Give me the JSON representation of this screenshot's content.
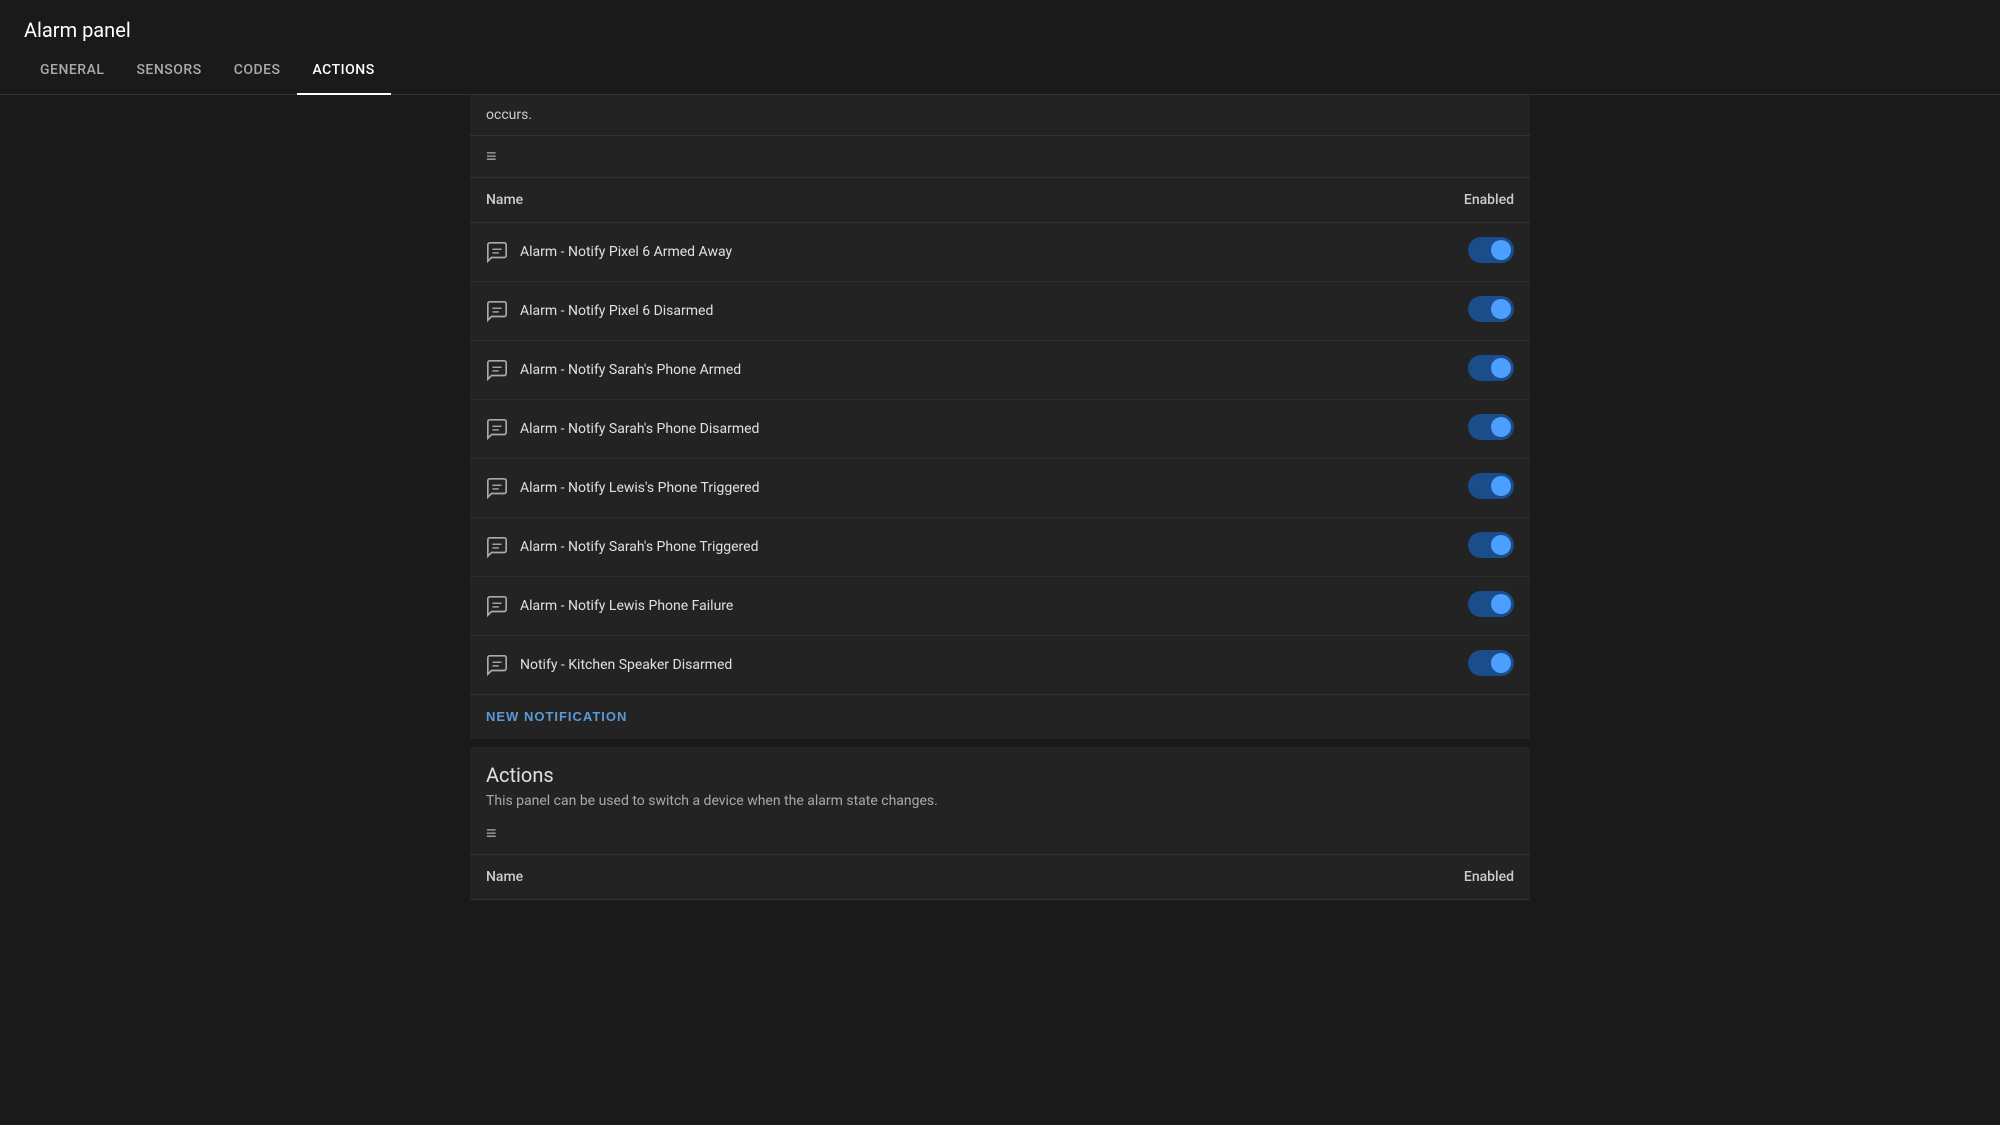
{
  "app": {
    "title": "Alarm panel"
  },
  "tabs": [
    {
      "id": "general",
      "label": "GENERAL",
      "active": false
    },
    {
      "id": "sensors",
      "label": "SENSORS",
      "active": false
    },
    {
      "id": "codes",
      "label": "CODES",
      "active": false
    },
    {
      "id": "actions",
      "label": "ACTIONS",
      "active": true
    }
  ],
  "partial_text": "occurs.",
  "notifications": {
    "filter_icon": "≡",
    "col_name": "Name",
    "col_enabled": "Enabled",
    "items": [
      {
        "id": 1,
        "name": "Alarm - Notify Pixel 6 Armed Away",
        "enabled": true
      },
      {
        "id": 2,
        "name": "Alarm - Notify Pixel 6 Disarmed",
        "enabled": true
      },
      {
        "id": 3,
        "name": "Alarm - Notify Sarah's Phone Armed",
        "enabled": true
      },
      {
        "id": 4,
        "name": "Alarm - Notify Sarah's Phone Disarmed",
        "enabled": true
      },
      {
        "id": 5,
        "name": "Alarm - Notify Lewis's Phone Triggered",
        "enabled": true
      },
      {
        "id": 6,
        "name": "Alarm - Notify Sarah's Phone Triggered",
        "enabled": true
      },
      {
        "id": 7,
        "name": "Alarm - Notify Lewis Phone Failure",
        "enabled": true
      },
      {
        "id": 8,
        "name": "Notify - Kitchen Speaker Disarmed",
        "enabled": true
      }
    ],
    "new_button_label": "NEW NOTIFICATION"
  },
  "actions": {
    "title": "Actions",
    "description": "This panel can be used to switch a device when the alarm state changes.",
    "filter_icon": "≡",
    "col_name": "Name",
    "col_enabled": "Enabled"
  }
}
